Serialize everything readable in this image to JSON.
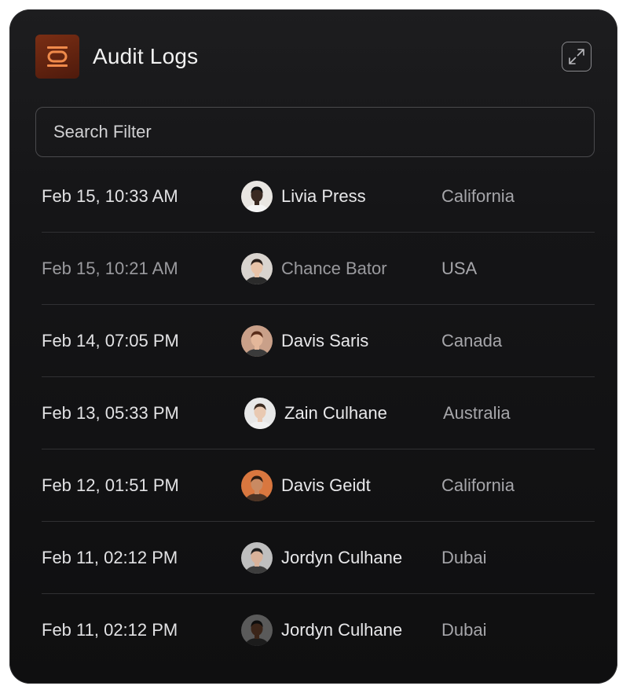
{
  "header": {
    "title": "Audit Logs",
    "app_icon": "stack-icon",
    "expand_icon": "expand-icon"
  },
  "search": {
    "placeholder": "Search Filter",
    "value": ""
  },
  "logs": [
    {
      "date": "Feb 15, 10:33 AM",
      "name": "Livia Press",
      "location": "California",
      "avatar_bg": "#e9e6e2",
      "skin": "#3a2a22",
      "hair": "#111111",
      "shirt": "#f5f5f5"
    },
    {
      "date": "Feb 15, 10:21 AM",
      "name": "Chance Bator",
      "location": "USA",
      "avatar_bg": "#d9d4cf",
      "skin": "#e8c3a8",
      "hair": "#2a1f1a",
      "shirt": "#2b2b2b"
    },
    {
      "date": "Feb 14, 07:05 PM",
      "name": "Davis Saris",
      "location": "Canada",
      "avatar_bg": "#c9a089",
      "skin": "#e4b79a",
      "hair": "#5a2d1a",
      "shirt": "#3b3b3b"
    },
    {
      "date": "Feb 13, 05:33 PM",
      "name": "Zain Culhane",
      "location": "Australia",
      "avatar_bg": "#e8e8e8",
      "skin": "#e9c9b2",
      "hair": "#3a2a20",
      "shirt": "#f0f0f0"
    },
    {
      "date": "Feb 12, 01:51 PM",
      "name": "Davis Geidt",
      "location": "California",
      "avatar_bg": "#d9773f",
      "skin": "#c98a62",
      "hair": "#2a1a10",
      "shirt": "#4a3325"
    },
    {
      "date": "Feb 11, 02:12 PM",
      "name": "Jordyn Culhane",
      "location": "Dubai",
      "avatar_bg": "#bfbfbf",
      "skin": "#d8b29a",
      "hair": "#1e1e1e",
      "shirt": "#3d3d3d"
    },
    {
      "date": "Feb 11, 02:12 PM",
      "name": "Jordyn Culhane",
      "location": "Dubai",
      "avatar_bg": "#5a5a5a",
      "skin": "#3b2519",
      "hair": "#0d0d0d",
      "shirt": "#1c1c1c"
    }
  ],
  "colors": {
    "card_bg": "#151517",
    "accent_icon": "#f08a4b",
    "divider": "#303033"
  }
}
